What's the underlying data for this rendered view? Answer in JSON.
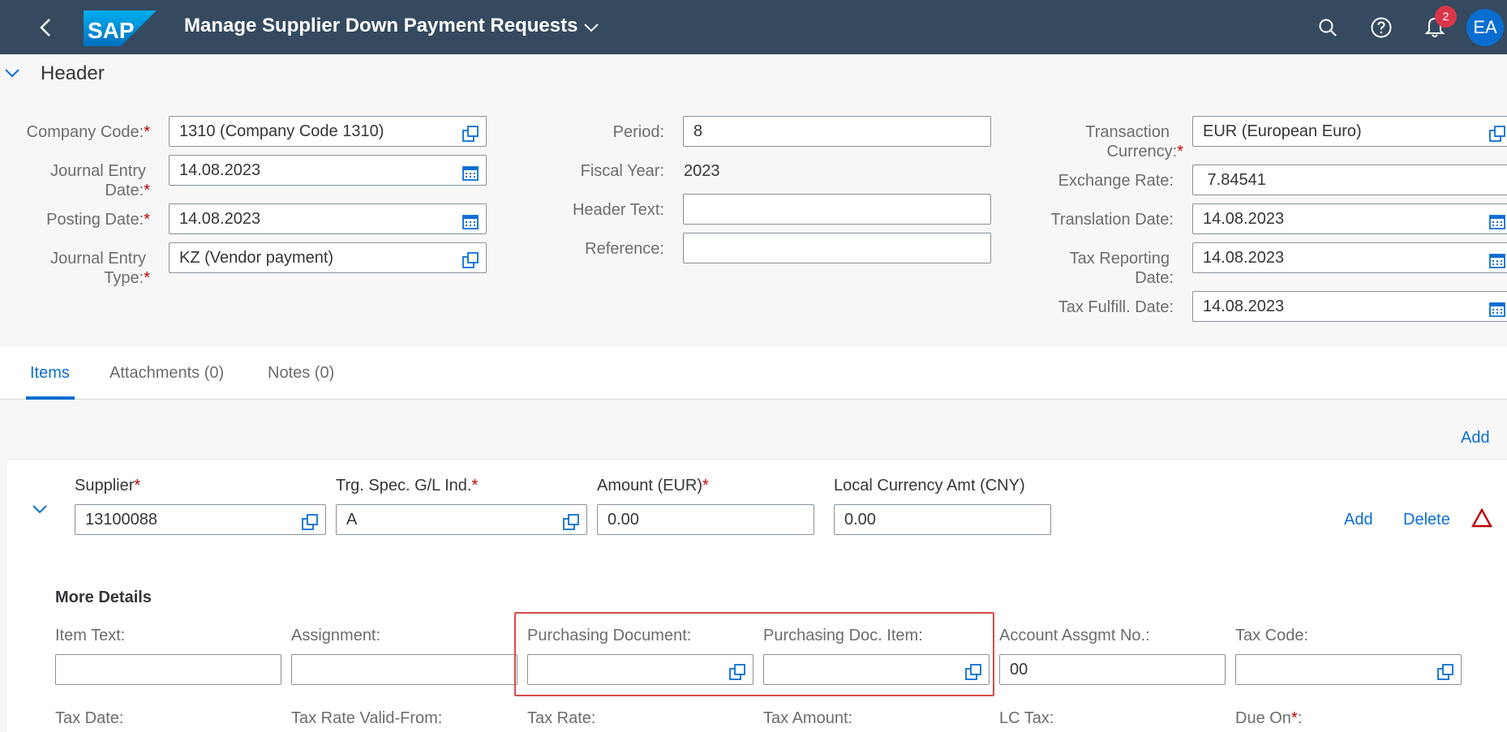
{
  "shell": {
    "app_title": "Manage Supplier Down Payment Requests",
    "logo_text": "SAP",
    "notification_count": "2",
    "user_initials": "EA"
  },
  "header": {
    "title": "Header",
    "company_code_label": "Company Code:",
    "company_code_value": "1310 (Company Code 1310)",
    "je_date_label_1": "Journal Entry",
    "je_date_label_2": "Date:",
    "je_date_value": "14.08.2023",
    "posting_date_label": "Posting Date:",
    "posting_date_value": "14.08.2023",
    "je_type_label_1": "Journal Entry",
    "je_type_label_2": "Type:",
    "je_type_value": "KZ (Vendor payment)",
    "period_label": "Period:",
    "period_value": "8",
    "fiscal_year_label": "Fiscal Year:",
    "fiscal_year_value": "2023",
    "header_text_label": "Header Text:",
    "header_text_value": "",
    "reference_label": "Reference:",
    "reference_value": "",
    "currency_label_1": "Transaction",
    "currency_label_2": "Currency:",
    "currency_value": "EUR (European Euro)",
    "exchange_rate_label": "Exchange Rate:",
    "exchange_rate_value": " 7.84541",
    "translation_date_label": "Translation Date:",
    "translation_date_value": "14.08.2023",
    "tax_reporting_label_1": "Tax Reporting",
    "tax_reporting_label_2": "Date:",
    "tax_reporting_value": "14.08.2023",
    "tax_fulfill_label": "Tax Fulfill. Date:",
    "tax_fulfill_value": "14.08.2023",
    "required_mark": "*"
  },
  "tabs": [
    {
      "label": "Items",
      "active": true
    },
    {
      "label": "Attachments (0)",
      "active": false
    },
    {
      "label": "Notes (0)",
      "active": false
    }
  ],
  "items": {
    "add_label": "Add",
    "row": {
      "supplier_label": "Supplier",
      "supplier_value": "13100088",
      "gl_ind_label": "Trg. Spec. G/L Ind.",
      "gl_ind_value": "A",
      "amount_label": "Amount (EUR)",
      "amount_value": "0.00",
      "local_amt_label": "Local Currency Amt (CNY)",
      "local_amt_value": "0.00",
      "add_label": "Add",
      "delete_label": "Delete"
    },
    "more_details": {
      "title": "More Details",
      "item_text_label": "Item Text:",
      "item_text_value": "",
      "assignment_label": "Assignment:",
      "assignment_value": "",
      "purch_doc_label": "Purchasing Document:",
      "purch_doc_value": "",
      "purch_doc_item_label": "Purchasing Doc. Item:",
      "purch_doc_item_value": "",
      "acct_assgmt_label": "Account Assgmt No.:",
      "acct_assgmt_value": "00",
      "tax_code_label": "Tax Code:",
      "tax_code_value": "",
      "tax_date_label": "Tax Date:",
      "tax_rate_valid_label": "Tax Rate Valid-From:",
      "tax_rate_label": "Tax Rate:",
      "tax_amount_label": "Tax Amount:",
      "lc_tax_label": "LC Tax:",
      "due_on_label": "Due On"
    }
  },
  "colors": {
    "shell": "#354a5f",
    "accent": "#0a6ed1",
    "required": "#bb0000",
    "highlight": "#d84a4a"
  }
}
